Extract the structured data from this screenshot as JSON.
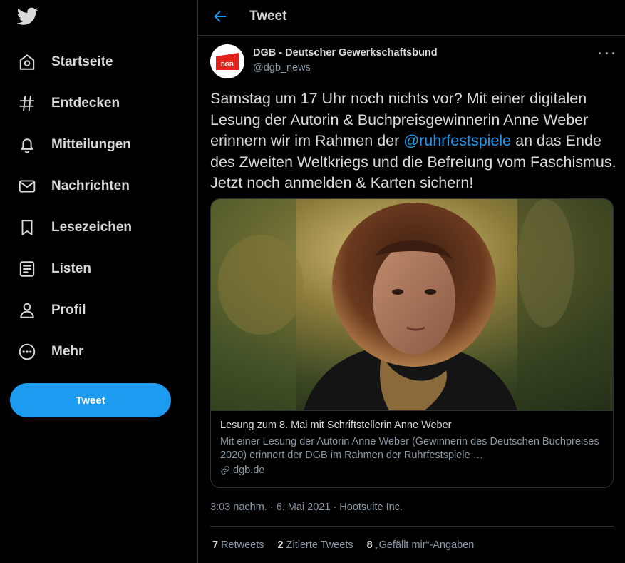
{
  "sidebar": {
    "logo_icon": "twitter-bird-icon",
    "items": [
      {
        "label": "Startseite",
        "icon": "home-icon"
      },
      {
        "label": "Entdecken",
        "icon": "hashtag-icon"
      },
      {
        "label": "Mitteilungen",
        "icon": "bell-icon"
      },
      {
        "label": "Nachrichten",
        "icon": "envelope-icon"
      },
      {
        "label": "Lesezeichen",
        "icon": "bookmark-icon"
      },
      {
        "label": "Listen",
        "icon": "list-icon"
      },
      {
        "label": "Profil",
        "icon": "person-icon"
      },
      {
        "label": "Mehr",
        "icon": "more-circle-icon"
      }
    ],
    "tweet_button": "Tweet"
  },
  "header": {
    "title": "Tweet",
    "back_icon": "arrow-left-icon"
  },
  "tweet": {
    "author_name": "DGB - Deutscher Gewerkschaftsbund",
    "author_handle": "@dgb_news",
    "avatar_text": "DGB",
    "text_part1": "Samstag um 17 Uhr noch nichts vor? Mit einer digitalen Lesung der Autorin & Buchpreisgewinnerin Anne Weber erinnern wir im Rahmen der ",
    "mention": "@ruhrfestspiele",
    "text_part2": " an das Ende des Zweiten Weltkriegs und die Befreiung vom Faschismus. Jetzt noch anmelden & Karten sichern!",
    "card": {
      "title": "Lesung zum 8. Mai mit Schriftstellerin Anne Weber",
      "description": "Mit einer Lesung der Autorin Anne Weber (Gewinnerin des Deutschen Buchpreises 2020) erinnert der DGB im Rahmen der Ruhrfestspiele …",
      "domain": "dgb.de"
    },
    "time": "3:03 nachm.",
    "date": "6. Mai 2021",
    "source": "Hootsuite Inc.",
    "separator": "·",
    "stats": {
      "retweets_count": "7",
      "retweets_label": "Retweets",
      "quotes_count": "2",
      "quotes_label": "Zitierte Tweets",
      "likes_count": "8",
      "likes_label": "„Gefällt mir“-Angaben"
    }
  },
  "colors": {
    "accent": "#1d9bf0",
    "background": "#000000",
    "text": "#d9d9d9",
    "muted": "#8b98a5",
    "border": "#2f3336",
    "dgb_red": "#e2231a"
  }
}
